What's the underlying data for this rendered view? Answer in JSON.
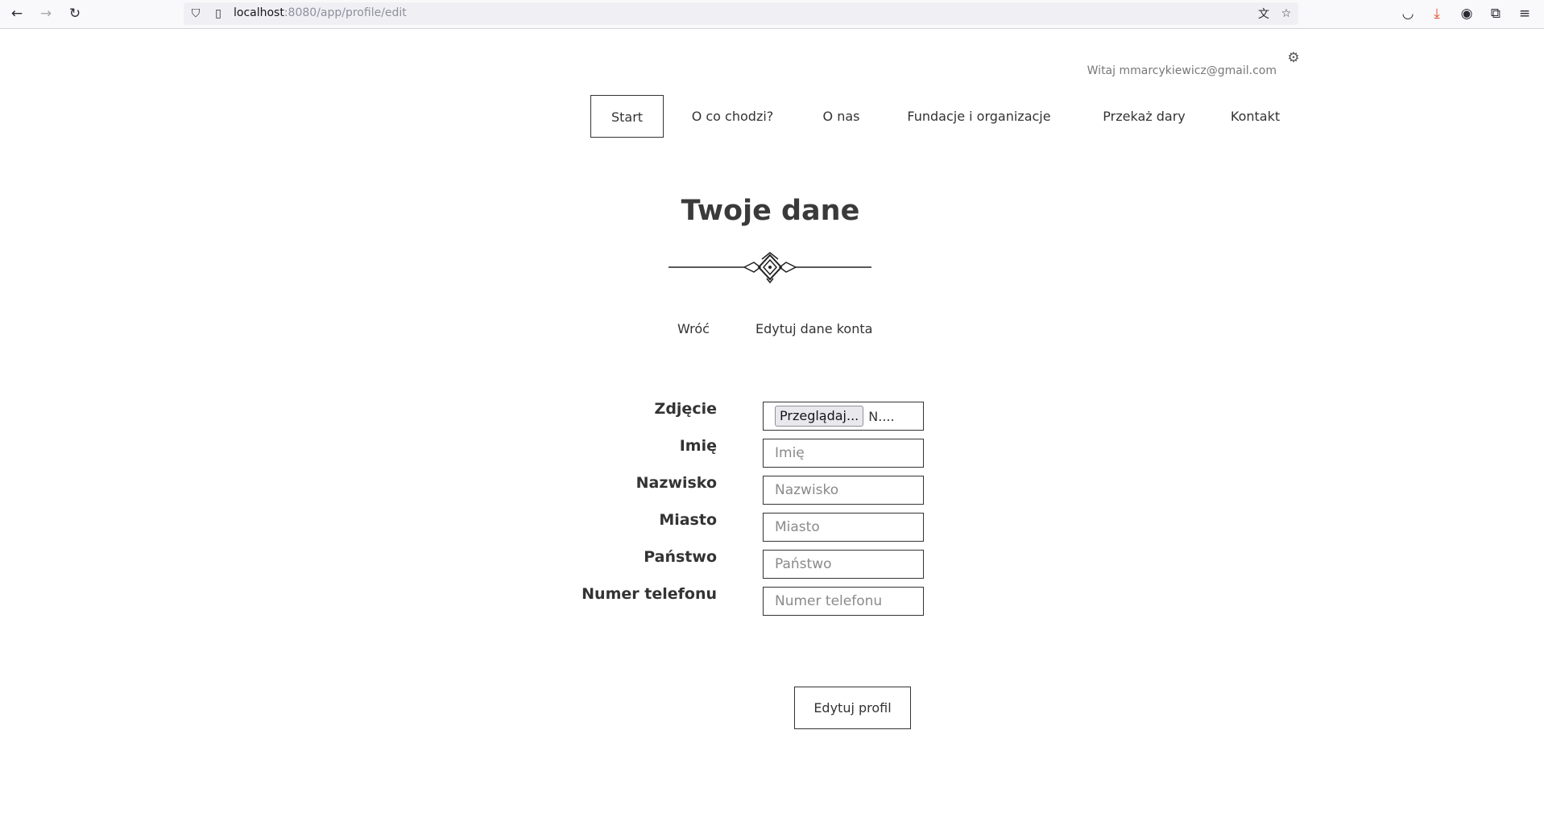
{
  "browser": {
    "url_host": "localhost",
    "url_rest": ":8080/app/profile/edit"
  },
  "header": {
    "greeting": "Witaj mmarcykiewicz@gmail.com"
  },
  "nav": {
    "items": [
      {
        "label": "Start",
        "active": true
      },
      {
        "label": "O co chodzi?",
        "active": false
      },
      {
        "label": "O nas",
        "active": false
      },
      {
        "label": "Fundacje i organizacje",
        "active": false
      },
      {
        "label": "Przekaż dary",
        "active": false
      },
      {
        "label": "Kontakt",
        "active": false
      }
    ]
  },
  "page": {
    "title": "Twoje dane",
    "back_link": "Wróć",
    "edit_account_link": "Edytuj dane konta"
  },
  "form": {
    "photo_label": "Zdjęcie",
    "photo_button": "Przeglądaj...",
    "photo_status": "N....",
    "first_name_label": "Imię",
    "first_name_placeholder": "Imię",
    "last_name_label": "Nazwisko",
    "last_name_placeholder": "Nazwisko",
    "city_label": "Miasto",
    "city_placeholder": "Miasto",
    "country_label": "Państwo",
    "country_placeholder": "Państwo",
    "phone_label": "Numer telefonu",
    "phone_placeholder": "Numer telefonu",
    "submit_label": "Edytuj profil"
  }
}
